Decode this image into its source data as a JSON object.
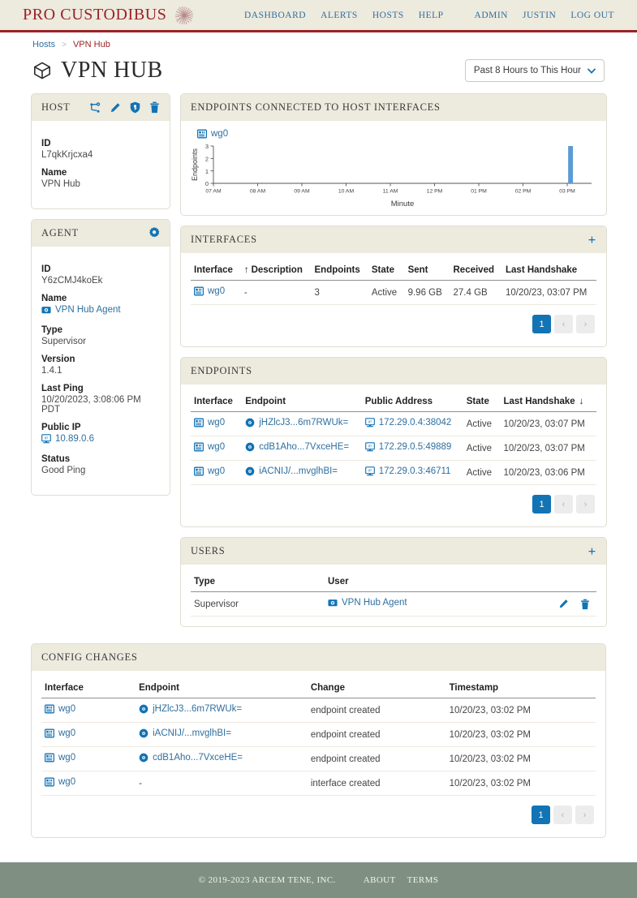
{
  "header": {
    "brand": "PRO CUSTODIBUS",
    "brand_mark_icon": "sunburst-logo-icon",
    "nav_primary": [
      {
        "label": "DASHBOARD",
        "name": "nav-dashboard"
      },
      {
        "label": "ALERTS",
        "name": "nav-alerts"
      },
      {
        "label": "HOSTS",
        "name": "nav-hosts"
      },
      {
        "label": "HELP",
        "name": "nav-help"
      }
    ],
    "nav_secondary": [
      {
        "label": "ADMIN",
        "name": "nav-admin"
      },
      {
        "label": "JUSTIN",
        "name": "nav-justin"
      },
      {
        "label": "LOG OUT",
        "name": "nav-logout"
      }
    ]
  },
  "breadcrumb": {
    "root": "Hosts",
    "separator": ">",
    "current": "VPN Hub"
  },
  "page": {
    "title": "VPN HUB",
    "title_icon": "cube-icon",
    "range_selector": {
      "value": "Past 8 Hours to This Hour",
      "caret_icon": "chevron-down-icon"
    }
  },
  "host_card": {
    "title": "HOST",
    "actions": [
      {
        "name": "host-topology-icon",
        "label": "topology"
      },
      {
        "name": "host-edit-icon",
        "label": "edit"
      },
      {
        "name": "host-key-shield-icon",
        "label": "keys"
      },
      {
        "name": "host-delete-icon",
        "label": "delete"
      }
    ],
    "fields": [
      {
        "label": "ID",
        "value": "L7qkKrjcxa4"
      },
      {
        "label": "Name",
        "value": "VPN Hub"
      }
    ]
  },
  "agent_card": {
    "title": "AGENT",
    "gear_icon": "gear-icon",
    "id_label": "ID",
    "id_value": "Y6zCMJ4koEk",
    "name_label": "Name",
    "name_value": "VPN Hub Agent",
    "name_icon": "agent-icon",
    "type_label": "Type",
    "type_value": "Supervisor",
    "version_label": "Version",
    "version_value": "1.4.1",
    "last_ping_label": "Last Ping",
    "last_ping_value": "10/20/2023, 3:08:06 PM PDT",
    "public_ip_label": "Public IP",
    "public_ip_value": "10.89.0.6",
    "public_ip_icon": "monitor-ip-icon",
    "status_label": "Status",
    "status_value": "Good Ping"
  },
  "chart_card": {
    "title": "ENDPOINTS CONNECTED TO HOST INTERFACES",
    "legend_label": "wg0",
    "legend_icon": "interface-icon"
  },
  "chart_data": {
    "type": "bar",
    "title": "ENDPOINTS CONNECTED TO HOST INTERFACES",
    "xlabel": "Minute",
    "ylabel": "Endpoints",
    "ylim": [
      0,
      3
    ],
    "yticks": [
      "0",
      "1",
      "2",
      "3"
    ],
    "xticks": [
      "07 AM",
      "08 AM",
      "09 AM",
      "10 AM",
      "11 AM",
      "12 PM",
      "01 PM",
      "02 PM",
      "03 PM"
    ],
    "grid": false,
    "legend_position": "top-left",
    "series": [
      {
        "name": "wg0",
        "color": "#5b9bd5",
        "points": [
          {
            "x": "03:02 PM",
            "y": 3
          },
          {
            "x": "03:03 PM",
            "y": 3
          },
          {
            "x": "03:04 PM",
            "y": 3
          },
          {
            "x": "03:05 PM",
            "y": 3
          },
          {
            "x": "03:06 PM",
            "y": 3
          },
          {
            "x": "03:07 PM",
            "y": 3
          }
        ]
      }
    ]
  },
  "interfaces_card": {
    "title": "INTERFACES",
    "add_icon": "plus-icon",
    "columns": [
      "Interface",
      "Description",
      "Endpoints",
      "State",
      "Sent",
      "Received",
      "Last Handshake"
    ],
    "sorted_column": "Description",
    "sort_direction": "asc",
    "rows": [
      {
        "interface": "wg0",
        "interface_icon": "interface-icon",
        "description": "-",
        "endpoints": "3",
        "state": "Active",
        "sent": "9.96 GB",
        "received": "27.4 GB",
        "last_handshake": "10/20/23, 03:07 PM"
      }
    ],
    "pager": {
      "current": "1",
      "prev_icon": "chevron-left-icon",
      "next_icon": "chevron-right-icon"
    }
  },
  "endpoints_card": {
    "title": "ENDPOINTS",
    "columns": [
      "Interface",
      "Endpoint",
      "Public Address",
      "State",
      "Last Handshake"
    ],
    "sorted_column": "Last Handshake",
    "sort_direction": "desc",
    "rows": [
      {
        "interface": "wg0",
        "interface_icon": "interface-icon",
        "endpoint": "jHZlcJ3...6m7RWUk=",
        "endpoint_icon": "endpoint-icon",
        "public_address": "172.29.0.4:38042",
        "address_icon": "monitor-ip-icon",
        "state": "Active",
        "last_handshake": "10/20/23, 03:07 PM"
      },
      {
        "interface": "wg0",
        "interface_icon": "interface-icon",
        "endpoint": "cdB1Aho...7VxceHE=",
        "endpoint_icon": "endpoint-icon",
        "public_address": "172.29.0.5:49889",
        "address_icon": "monitor-ip-icon",
        "state": "Active",
        "last_handshake": "10/20/23, 03:07 PM"
      },
      {
        "interface": "wg0",
        "interface_icon": "interface-icon",
        "endpoint": "iACNIJ/...mvglhBI=",
        "endpoint_icon": "endpoint-icon",
        "public_address": "172.29.0.3:46711",
        "address_icon": "monitor-ip-icon",
        "state": "Active",
        "last_handshake": "10/20/23, 03:06 PM"
      }
    ],
    "pager": {
      "current": "1",
      "prev_icon": "chevron-left-icon",
      "next_icon": "chevron-right-icon"
    }
  },
  "users_card": {
    "title": "USERS",
    "add_icon": "plus-icon",
    "columns": [
      "Type",
      "User"
    ],
    "rows": [
      {
        "type": "Supervisor",
        "user": "VPN Hub Agent",
        "user_icon": "agent-icon",
        "edit_icon": "edit-icon",
        "delete_icon": "delete-icon"
      }
    ]
  },
  "config_changes_card": {
    "title": "CONFIG CHANGES",
    "columns": [
      "Interface",
      "Endpoint",
      "Change",
      "Timestamp"
    ],
    "rows": [
      {
        "interface": "wg0",
        "interface_icon": "interface-icon",
        "endpoint": "jHZlcJ3...6m7RWUk=",
        "endpoint_icon": "endpoint-icon",
        "change": "endpoint created",
        "timestamp": "10/20/23, 03:02 PM"
      },
      {
        "interface": "wg0",
        "interface_icon": "interface-icon",
        "endpoint": "iACNIJ/...mvglhBI=",
        "endpoint_icon": "endpoint-icon",
        "change": "endpoint created",
        "timestamp": "10/20/23, 03:02 PM"
      },
      {
        "interface": "wg0",
        "interface_icon": "interface-icon",
        "endpoint": "cdB1Aho...7VxceHE=",
        "endpoint_icon": "endpoint-icon",
        "change": "endpoint created",
        "timestamp": "10/20/23, 03:02 PM"
      },
      {
        "interface": "wg0",
        "interface_icon": "interface-icon",
        "endpoint": "-",
        "endpoint_icon": null,
        "change": "interface created",
        "timestamp": "10/20/23, 03:02 PM"
      }
    ],
    "pager": {
      "current": "1",
      "prev_icon": "chevron-left-icon",
      "next_icon": "chevron-right-icon"
    }
  },
  "footer": {
    "copyright": "© 2019-2023 ARCEM TENE, INC.",
    "links": [
      {
        "label": "ABOUT",
        "name": "footer-about-link"
      },
      {
        "label": "TERMS",
        "name": "footer-terms-link"
      }
    ]
  },
  "colors": {
    "brand_red": "#9b2226",
    "link_blue": "#2f6f9f",
    "accent_blue": "#1273b5",
    "bar_blue": "#5b9bd5",
    "panel_head": "#edeade",
    "state_green": "#4e9a3e",
    "footer_green": "#7f9083"
  }
}
